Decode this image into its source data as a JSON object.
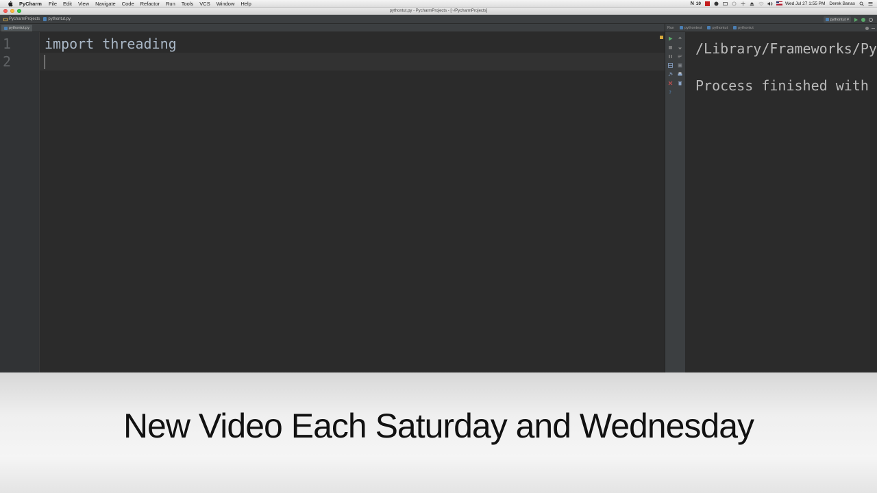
{
  "menubar": {
    "app_name": "PyCharm",
    "items": [
      "File",
      "Edit",
      "View",
      "Navigate",
      "Code",
      "Refactor",
      "Run",
      "Tools",
      "VCS",
      "Window",
      "Help"
    ],
    "tray_badge": "10",
    "clock": "Wed Jul 27  1:55 PM",
    "user": "Derek Banas"
  },
  "window": {
    "title": "pythontut.py - PycharmProjects - [~/PycharmProjects]"
  },
  "navbar": {
    "project": "PycharmProjects",
    "file": "pythontut.py",
    "run_config": "pythontut"
  },
  "editor": {
    "tab": "pythontut.py",
    "line_numbers": [
      "1",
      "2"
    ],
    "lines": [
      "import threading",
      ""
    ]
  },
  "run_panel": {
    "label": "Run",
    "tabs": [
      "pythontest",
      "pythontut",
      "pythontut"
    ],
    "console_lines": [
      "/Library/Frameworks/Py",
      "Process finished with"
    ]
  },
  "caption": {
    "text": "New Video Each Saturday and Wednesday"
  },
  "colors": {
    "editor_bg": "#2b2b2b",
    "gutter_bg": "#313335",
    "code_text": "#a9b7c6",
    "caption_text": "#111111"
  }
}
